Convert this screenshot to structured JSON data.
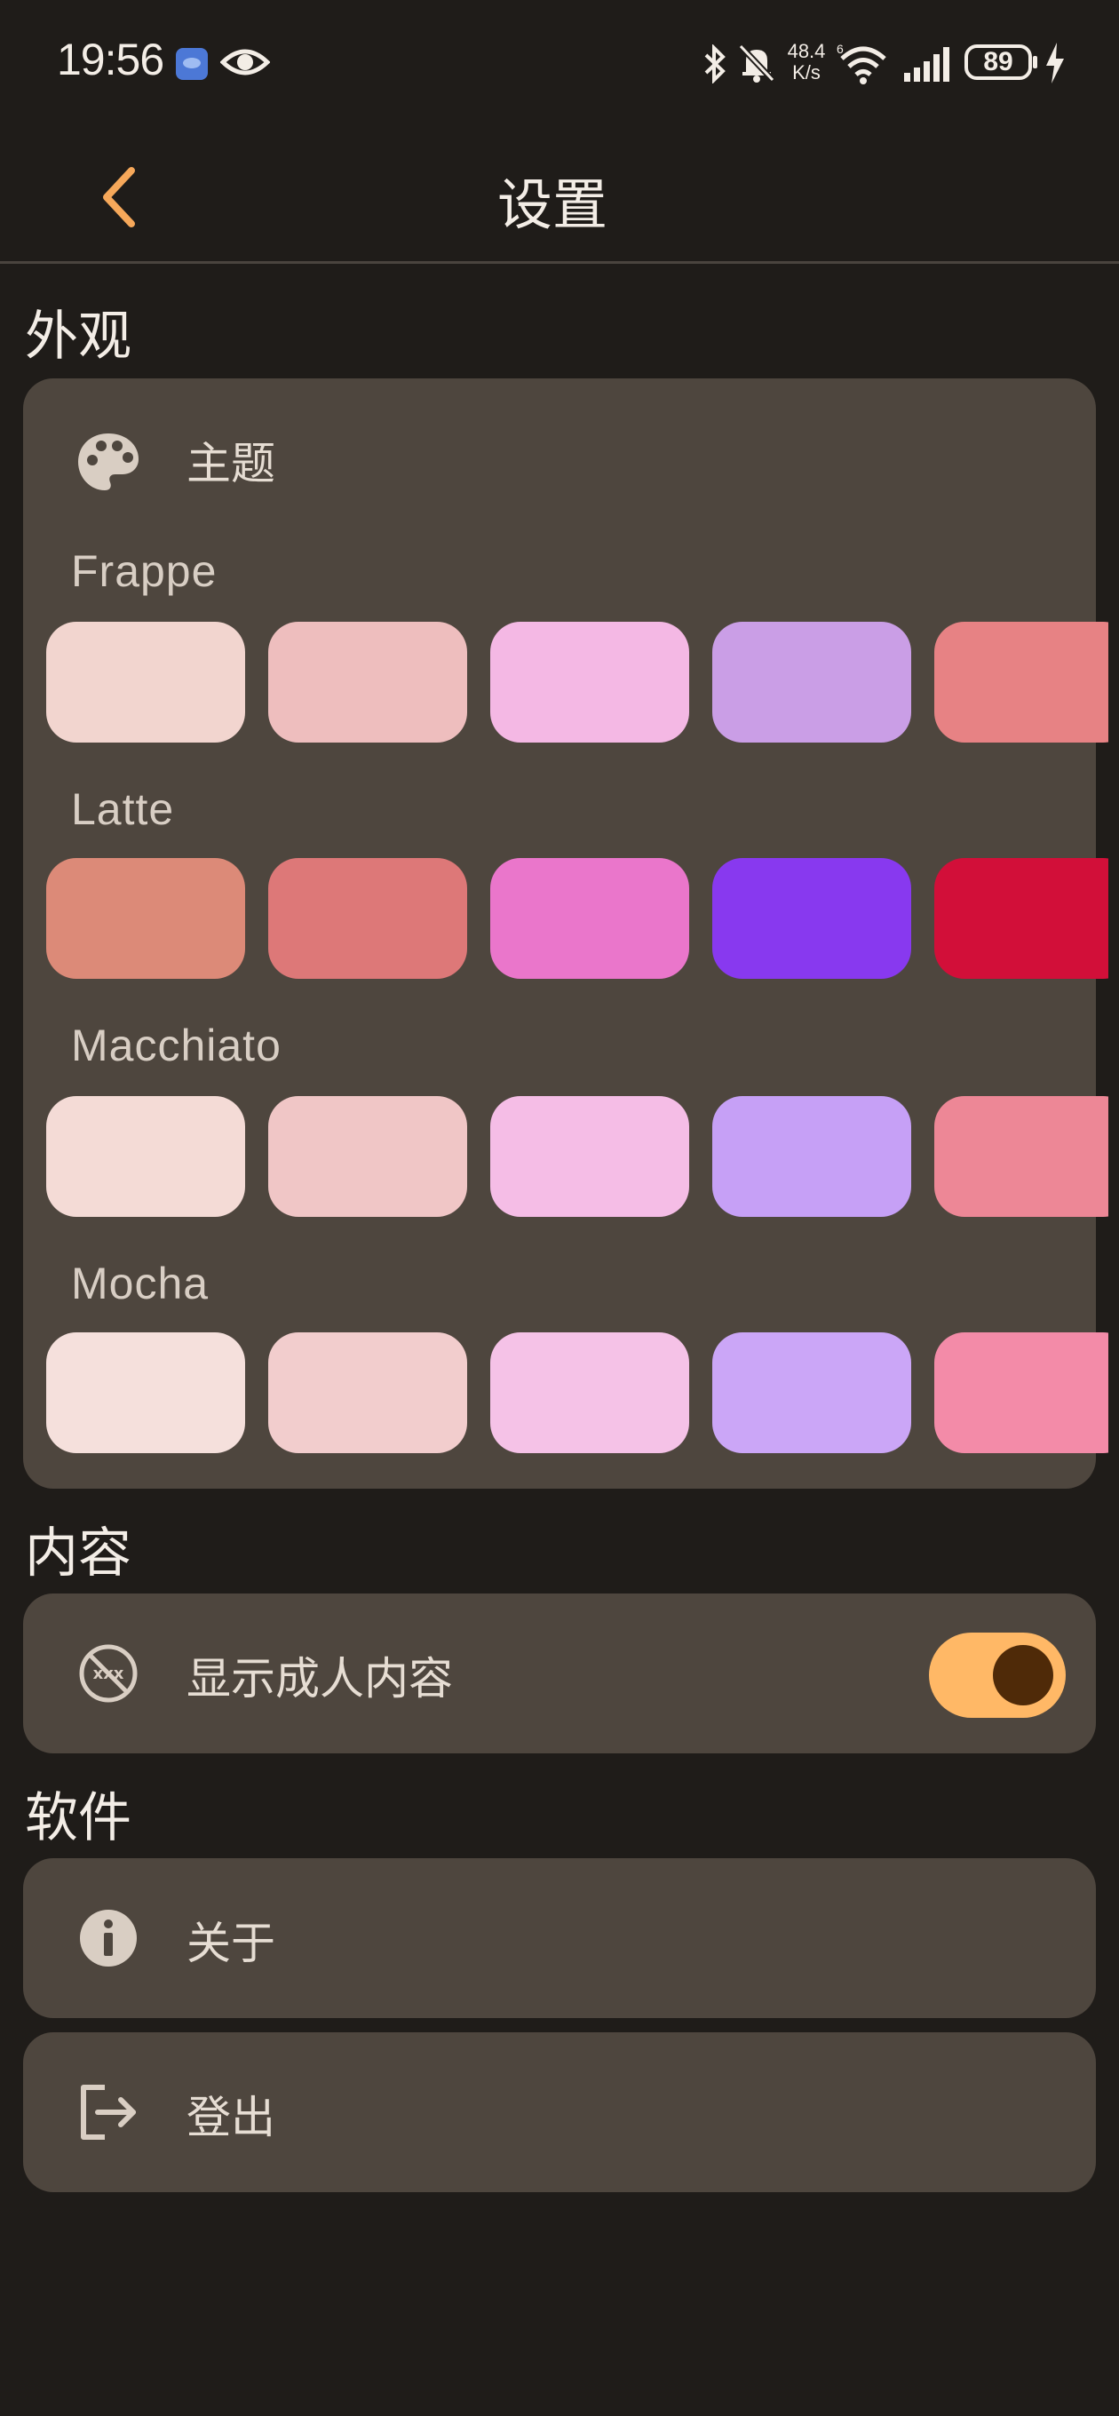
{
  "status_bar": {
    "time": "19:56",
    "net_speed_value": "48.4",
    "net_speed_unit": "K/s",
    "battery": "89"
  },
  "app_bar": {
    "title": "设置",
    "back_icon": "chevron-left-icon",
    "accent_color": "#f6a85a"
  },
  "sections": {
    "appearance": {
      "title": "外观",
      "theme_row": {
        "icon": "palette-icon",
        "label": "主题"
      },
      "themes": [
        {
          "name": "Frappe",
          "colors": [
            "#f2d5cf",
            "#eebebe",
            "#f4b8e4",
            "#ca9ee6",
            "#e78284"
          ]
        },
        {
          "name": "Latte",
          "colors": [
            "#dc8a78",
            "#dd7878",
            "#ea76cb",
            "#8839ef",
            "#d20f39"
          ]
        },
        {
          "name": "Macchiato",
          "colors": [
            "#f4dbd6",
            "#f0c6c6",
            "#f5bde6",
            "#c6a0f6",
            "#ed8796"
          ]
        },
        {
          "name": "Mocha",
          "colors": [
            "#f5e0dc",
            "#f2cdcd",
            "#f5c2e7",
            "#cba6f7",
            "#f38ba8"
          ]
        }
      ]
    },
    "content": {
      "title": "内容",
      "adult_row": {
        "icon": "no-adult-content-icon",
        "label": "显示成人内容",
        "toggle_on": true
      }
    },
    "software": {
      "title": "软件",
      "about_row": {
        "icon": "info-icon",
        "label": "关于"
      },
      "logout_row": {
        "icon": "logout-icon",
        "label": "登出"
      }
    }
  }
}
